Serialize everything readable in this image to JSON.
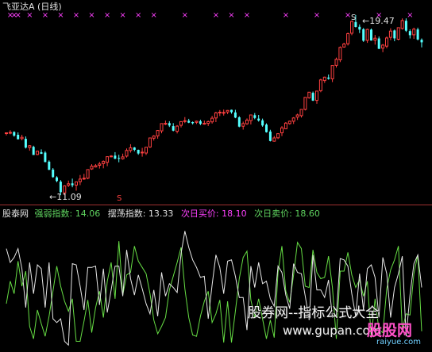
{
  "header": {
    "title": "飞亚达A",
    "period": "(日线)"
  },
  "upper_panel": {
    "high_label": "19.47",
    "low_label": "11.09",
    "signal_marker": "S",
    "top_marker": "×"
  },
  "indicator_panel": {
    "source_label": "股泰网",
    "strength_label": "强弱指数:",
    "strength_value": "14.06",
    "swing_label": "摆荡指数:",
    "swing_value": "13.33",
    "buy_label": "次日买价:",
    "buy_value": "18.10",
    "sell_label": "次日卖价:",
    "sell_value": "18.60"
  },
  "watermark": {
    "line1": "股券网--指标公式大全",
    "line2": "www.gupan.com",
    "logo_text": "股股网",
    "logo_url": "raiyue.com"
  },
  "colors": {
    "up": "#ff4040",
    "down": "#54ffff",
    "strength_line": "#66dd44",
    "swing_line": "#e6e6e6",
    "magenta": "#ff40ff",
    "divider": "#a03030",
    "label_white": "#e0e0e0",
    "label_green": "#5fd35f",
    "label_magenta": "#ff40ff"
  },
  "chart_data": [
    {
      "type": "candlestick",
      "title": "飞亚达A (日线)",
      "candles": [
        [
          13.97,
          14.0,
          13.87,
          13.99
        ],
        [
          14.01,
          14.11,
          13.92,
          14.01
        ],
        [
          14.03,
          14.06,
          13.81,
          13.86
        ],
        [
          13.9,
          14.01,
          13.69,
          13.69
        ],
        [
          13.72,
          13.9,
          13.64,
          13.78
        ],
        [
          13.71,
          13.82,
          13.26,
          13.3
        ],
        [
          13.31,
          13.42,
          13.16,
          13.39
        ],
        [
          13.34,
          13.39,
          12.96,
          12.96
        ],
        [
          12.98,
          13.14,
          12.95,
          13.14
        ],
        [
          13.09,
          13.22,
          13.01,
          13.01
        ],
        [
          13.07,
          13.14,
          12.62,
          12.63
        ],
        [
          12.65,
          12.71,
          12.26,
          12.27
        ],
        [
          12.28,
          12.35,
          11.9,
          11.93
        ],
        [
          11.92,
          11.97,
          11.69,
          11.75
        ],
        [
          11.72,
          11.79,
          11.09,
          11.23
        ],
        [
          11.2,
          11.55,
          11.09,
          11.52
        ],
        [
          11.55,
          11.77,
          11.47,
          11.62
        ],
        [
          11.64,
          11.86,
          11.46,
          11.55
        ],
        [
          11.56,
          11.71,
          11.3,
          11.71
        ],
        [
          11.72,
          12.03,
          11.56,
          11.84
        ],
        [
          11.86,
          12.08,
          11.8,
          11.88
        ],
        [
          11.88,
          12.29,
          11.83,
          12.28
        ],
        [
          12.31,
          12.53,
          12.27,
          12.44
        ],
        [
          12.4,
          12.54,
          12.38,
          12.46
        ],
        [
          12.48,
          12.64,
          12.33,
          12.54
        ],
        [
          12.56,
          12.71,
          12.34,
          12.66
        ],
        [
          12.62,
          12.88,
          12.44,
          12.88
        ],
        [
          12.91,
          12.95,
          12.85,
          12.91
        ],
        [
          12.93,
          13.09,
          12.76,
          12.79
        ],
        [
          12.82,
          12.97,
          12.62,
          12.81
        ],
        [
          12.78,
          13.02,
          12.74,
          12.87
        ],
        [
          12.91,
          13.26,
          12.84,
          13.17
        ],
        [
          13.17,
          13.46,
          13.07,
          13.29
        ],
        [
          13.31,
          13.33,
          13.13,
          13.2
        ],
        [
          13.2,
          13.21,
          12.97,
          13.03
        ],
        [
          13.06,
          13.29,
          12.88,
          13.09
        ],
        [
          13.05,
          13.32,
          12.96,
          13.32
        ],
        [
          13.33,
          13.77,
          13.29,
          13.75
        ],
        [
          13.74,
          13.88,
          13.63,
          13.84
        ],
        [
          13.85,
          14.12,
          13.72,
          14.1
        ],
        [
          14.08,
          14.43,
          13.97,
          14.42
        ],
        [
          14.42,
          14.56,
          14.35,
          14.43
        ],
        [
          14.44,
          14.53,
          14.26,
          14.33
        ],
        [
          14.3,
          14.44,
          14.06,
          14.09
        ],
        [
          14.06,
          14.35,
          13.96,
          14.3
        ],
        [
          14.34,
          14.52,
          14.24,
          14.51
        ],
        [
          14.54,
          14.72,
          14.44,
          14.55
        ],
        [
          14.55,
          14.64,
          14.44,
          14.46
        ],
        [
          14.49,
          14.52,
          14.38,
          14.44
        ],
        [
          14.48,
          14.55,
          14.4,
          14.53
        ],
        [
          14.53,
          14.6,
          14.35,
          14.41
        ],
        [
          14.4,
          14.56,
          14.37,
          14.43
        ],
        [
          14.43,
          14.56,
          14.31,
          14.51
        ],
        [
          14.5,
          14.78,
          14.42,
          14.67
        ],
        [
          14.68,
          14.97,
          14.49,
          14.92
        ],
        [
          14.94,
          15.05,
          14.77,
          14.95
        ],
        [
          14.94,
          15.07,
          14.79,
          14.94
        ],
        [
          14.96,
          15.05,
          14.86,
          15.03
        ],
        [
          15.06,
          15.07,
          14.88,
          14.95
        ],
        [
          14.94,
          15.06,
          14.67,
          14.7
        ],
        [
          14.71,
          14.76,
          14.25,
          14.28
        ],
        [
          14.3,
          14.51,
          14.14,
          14.42
        ],
        [
          14.41,
          14.66,
          14.36,
          14.58
        ],
        [
          14.56,
          14.84,
          14.38,
          14.82
        ],
        [
          14.81,
          14.91,
          14.62,
          14.68
        ],
        [
          14.65,
          14.82,
          14.51,
          14.56
        ],
        [
          14.57,
          14.65,
          14.27,
          14.33
        ],
        [
          14.37,
          14.43,
          14.0,
          14.02
        ],
        [
          14.05,
          14.13,
          13.59,
          13.61
        ],
        [
          13.6,
          13.84,
          13.58,
          13.75
        ],
        [
          13.76,
          13.95,
          13.7,
          13.95
        ],
        [
          13.99,
          14.3,
          13.84,
          14.22
        ],
        [
          14.18,
          14.49,
          14.16,
          14.44
        ],
        [
          14.42,
          14.56,
          14.37,
          14.53
        ],
        [
          14.53,
          14.72,
          14.4,
          14.68
        ],
        [
          14.72,
          14.88,
          14.59,
          14.82
        ],
        [
          14.79,
          15.08,
          14.7,
          15.08
        ],
        [
          15.08,
          15.64,
          15.03,
          15.64
        ],
        [
          15.62,
          15.88,
          15.58,
          15.88
        ],
        [
          15.85,
          15.91,
          15.47,
          15.49
        ],
        [
          15.5,
          15.94,
          15.34,
          15.93
        ],
        [
          15.95,
          16.5,
          15.88,
          16.45
        ],
        [
          16.42,
          16.6,
          16.31,
          16.58
        ],
        [
          16.56,
          16.7,
          16.46,
          16.5
        ],
        [
          16.5,
          17.12,
          16.35,
          17.12
        ],
        [
          17.13,
          17.49,
          17.02,
          17.41
        ],
        [
          17.38,
          18.01,
          17.28,
          17.96
        ],
        [
          17.98,
          18.18,
          17.95,
          18.12
        ],
        [
          18.13,
          18.65,
          18.05,
          18.6
        ],
        [
          18.62,
          19.21,
          18.53,
          19.17
        ],
        [
          19.14,
          19.47,
          18.89,
          18.91
        ],
        [
          18.92,
          19.03,
          18.63,
          18.79
        ],
        [
          18.81,
          18.86,
          18.22,
          18.27
        ],
        [
          18.29,
          18.83,
          18.17,
          18.8
        ],
        [
          18.79,
          18.84,
          18.28,
          18.28
        ],
        [
          18.3,
          18.54,
          18.09,
          18.39
        ],
        [
          18.38,
          18.47,
          17.88,
          17.9
        ],
        [
          17.93,
          18.12,
          17.74,
          18.07
        ],
        [
          18.02,
          18.47,
          17.92,
          18.4
        ],
        [
          18.43,
          18.85,
          18.3,
          18.72
        ],
        [
          18.75,
          18.79,
          18.25,
          18.38
        ],
        [
          18.34,
          18.89,
          18.29,
          18.88
        ],
        [
          18.84,
          19.31,
          18.79,
          19.21
        ],
        [
          19.2,
          19.31,
          18.68,
          18.74
        ],
        [
          18.72,
          18.8,
          18.38,
          18.53
        ],
        [
          18.55,
          18.88,
          18.36,
          18.81
        ],
        [
          18.8,
          18.88,
          18.29,
          18.33
        ],
        [
          18.32,
          18.38,
          17.96,
          18.2
        ]
      ],
      "high_marker": 19.47,
      "low_marker": 11.09,
      "ylim": [
        10.95,
        19.65
      ]
    },
    {
      "type": "line",
      "series": [
        {
          "name": "强弱指数",
          "values": [
            36,
            54,
            44,
            70,
            50,
            62,
            18,
            8,
            31,
            20,
            10,
            26,
            46,
            66,
            50,
            38,
            30,
            40,
            6,
            6,
            22,
            39,
            13,
            33,
            46,
            25,
            54,
            69,
            40,
            86,
            43,
            59,
            61,
            82,
            70,
            65,
            60,
            44,
            23,
            12,
            18,
            25,
            47,
            58,
            69,
            81,
            48,
            25,
            11,
            10,
            26,
            38,
            46,
            21,
            28,
            39,
            5,
            38,
            5,
            30,
            56,
            73,
            78,
            39,
            25,
            40,
            24,
            8,
            23,
            9,
            61,
            82,
            46,
            37,
            59,
            85,
            80,
            50,
            49,
            79,
            61,
            56,
            57,
            74,
            49,
            8,
            62,
            62,
            77,
            59,
            49,
            55,
            42,
            54,
            9,
            40,
            15,
            13,
            48,
            63,
            71,
            82,
            15,
            28,
            27,
            60,
            75,
            14
          ]
        },
        {
          "name": "摆荡指数",
          "values": [
            80,
            69,
            73,
            80,
            64,
            33,
            69,
            44,
            67,
            64,
            33,
            69,
            24,
            21,
            24,
            6,
            3,
            68,
            67,
            50,
            31,
            65,
            65,
            66,
            35,
            64,
            29,
            47,
            66,
            66,
            42,
            79,
            56,
            43,
            59,
            48,
            36,
            28,
            47,
            26,
            61,
            42,
            52,
            49,
            45,
            76,
            94,
            81,
            71,
            65,
            57,
            58,
            24,
            51,
            75,
            65,
            44,
            70,
            71,
            58,
            41,
            41,
            15,
            66,
            49,
            69,
            52,
            54,
            40,
            34,
            66,
            61,
            43,
            32,
            68,
            61,
            60,
            42,
            23,
            75,
            47,
            47,
            41,
            55,
            25,
            26,
            72,
            71,
            66,
            44,
            26,
            60,
            31,
            64,
            67,
            57,
            25,
            73,
            60,
            25,
            49,
            60,
            74,
            10,
            43,
            68,
            75,
            49
          ]
        }
      ],
      "ylim": [
        0,
        100
      ]
    }
  ]
}
